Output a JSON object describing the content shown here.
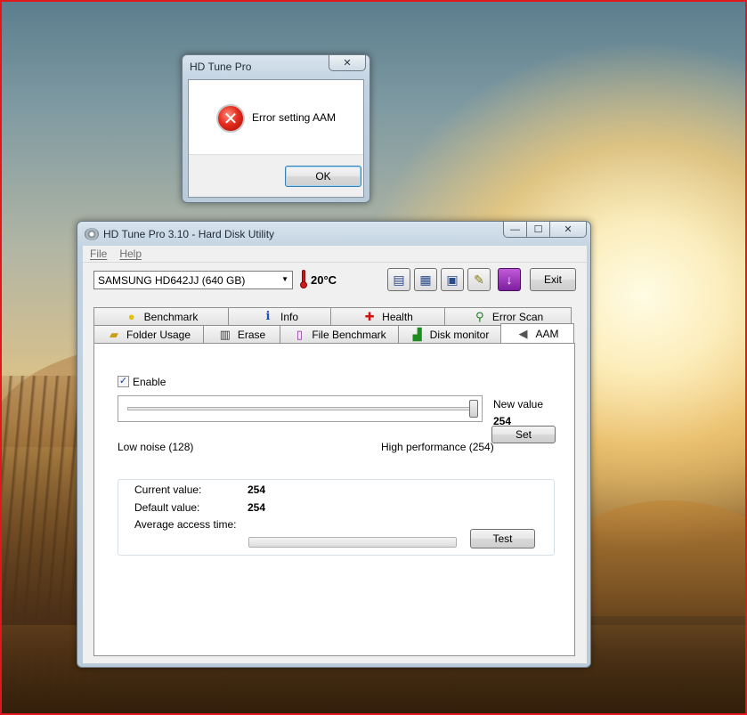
{
  "error_dialog": {
    "title": "HD Tune Pro",
    "message": "Error setting AAM",
    "ok_label": "OK"
  },
  "main_window": {
    "title": "HD Tune Pro 3.10 - Hard Disk Utility",
    "caption": {
      "minimize": "—",
      "maximize": "☐",
      "close": "✕"
    },
    "menu": [
      {
        "label": "File"
      },
      {
        "label": "Help"
      }
    ],
    "toolbar": {
      "drive": "SAMSUNG HD642JJ (640 GB)",
      "temperature": "20°C",
      "exit_label": "Exit"
    },
    "tabs_row1": [
      {
        "label": "Benchmark",
        "icon": "lightbulb-icon"
      },
      {
        "label": "Info",
        "icon": "info-icon"
      },
      {
        "label": "Health",
        "icon": "health-cross-icon"
      },
      {
        "label": "Error Scan",
        "icon": "magnifier-icon"
      }
    ],
    "tabs_row2": [
      {
        "label": "Folder Usage",
        "icon": "folder-icon"
      },
      {
        "label": "Erase",
        "icon": "trash-icon"
      },
      {
        "label": "File Benchmark",
        "icon": "file-benchmark-icon"
      },
      {
        "label": "Disk monitor",
        "icon": "disk-monitor-icon"
      },
      {
        "label": "AAM",
        "icon": "speaker-icon",
        "active": true
      }
    ],
    "aam": {
      "enable_label": "Enable",
      "enabled": true,
      "new_value_label": "New value",
      "new_value": "254",
      "slider": {
        "min": 128,
        "max": 254,
        "value": 254
      },
      "low_label": "Low noise (128)",
      "high_label": "High performance (254)",
      "set_label": "Set",
      "current_value_label": "Current value:",
      "current_value": "254",
      "default_value_label": "Default value:",
      "default_value": "254",
      "avg_access_label": "Average access time:",
      "progress": 0,
      "test_label": "Test"
    }
  }
}
